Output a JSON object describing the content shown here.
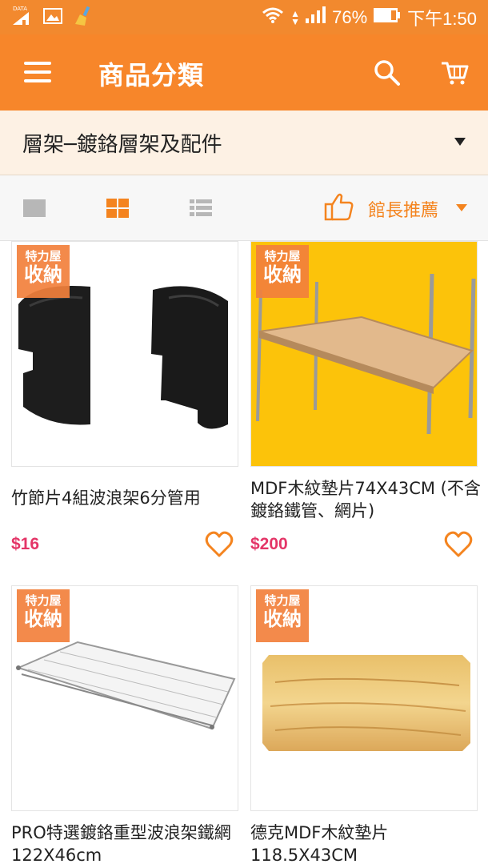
{
  "status_bar": {
    "data_label": "DATA",
    "wifi_icon": "wifi-icon",
    "battery": "76%",
    "time": "下午1:50"
  },
  "app_bar": {
    "title": "商品分類",
    "menu_icon": "menu-icon",
    "search_icon": "search-icon",
    "cart_icon": "cart-icon"
  },
  "category": {
    "selected": "層架─鍍鉻層架及配件"
  },
  "toolbar": {
    "views": [
      "single-view-icon",
      "grid-view-icon",
      "list-view-icon"
    ],
    "active_view": "grid",
    "sort_label": "館長推薦"
  },
  "badge": {
    "line1": "特力屋",
    "line2": "收納"
  },
  "products": [
    {
      "name": "竹節片4組波浪架6分管用",
      "price": "$16",
      "image": "black plastic sleeve clips"
    },
    {
      "name": "MDF木紋墊片74X43CM (不含鍍鉻鐵管、網片)",
      "price": "$200",
      "image": "wood shelf on chrome rack, yellow background"
    },
    {
      "name": "PRO特選鍍鉻重型波浪架鐵網 122X46cm",
      "price": "",
      "image": "chrome wire shelf"
    },
    {
      "name": "德克MDF木紋墊片 118.5X43CM",
      "price": "",
      "image": "wood grain board"
    }
  ],
  "colors": {
    "brand": "#f7862a",
    "price": "#e43567",
    "accent": "#f4841f"
  }
}
